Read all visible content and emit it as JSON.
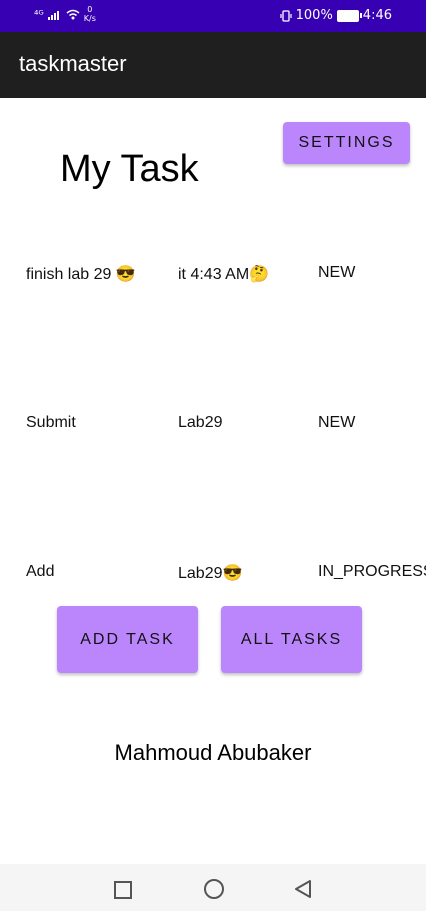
{
  "status_bar": {
    "network": "⁴ᴳ",
    "speed_value": "0",
    "speed_unit": "K/s",
    "battery": "100%",
    "time": "4:46"
  },
  "app_bar": {
    "title": "taskmaster"
  },
  "settings_button": "SETTINGS",
  "page_title": "My Task",
  "tasks": [
    {
      "title": "finish lab 29 😎",
      "body": "it 4:43 AM🤔",
      "state": "NEW"
    },
    {
      "title": "Submit",
      "body": "Lab29",
      "state": "NEW"
    },
    {
      "title": "Add",
      "body": "Lab29😎",
      "state": "IN_PROGRESS"
    }
  ],
  "buttons": {
    "add_task": "ADD TASK",
    "all_tasks": "ALL TASKS"
  },
  "footer_name": "Mahmoud Abubaker",
  "colors": {
    "status_bar": "#3700b3",
    "app_bar": "#1f1f1f",
    "accent": "#bb86fc"
  },
  "icons": [
    "signal-icon",
    "wifi-icon",
    "vibrate-icon",
    "battery-icon",
    "recent-apps-icon",
    "home-icon",
    "back-icon"
  ]
}
